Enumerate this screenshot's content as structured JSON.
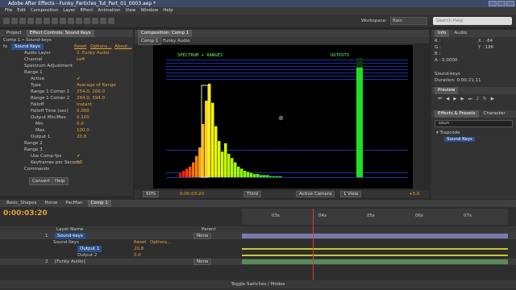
{
  "app": {
    "title": "Adobe After Effects - Funky_Particles_Tut_Part_01_0003.aep *"
  },
  "menu": [
    "File",
    "Edit",
    "Composition",
    "Layer",
    "Effect",
    "Animation",
    "View",
    "Window",
    "Help"
  ],
  "workspace": {
    "label": "Workspace:",
    "value": "Rain",
    "search_placeholder": "Search Help"
  },
  "fx_panel": {
    "tabs": [
      "Project",
      "Effect Controls: Sound Keys"
    ],
    "breadcrumb": "Comp 1 • Sound-keys",
    "effect_name": "Sound Keys",
    "reset": "Reset",
    "options": "Options...",
    "about": "About...",
    "rows": [
      {
        "label": "Audio Layer",
        "value": "2. Funky Audio"
      },
      {
        "label": "Channel",
        "value": "Left"
      },
      {
        "label": "Spectrum Adjustment",
        "value": ""
      },
      {
        "label": "Range 1",
        "value": ""
      },
      {
        "label": "Active",
        "value": "✔"
      },
      {
        "label": "Type",
        "value": "Average of Range"
      },
      {
        "label": "Range 1 Corner 1",
        "value": "254.0, 206.0"
      },
      {
        "label": "Range 1 Corner 2",
        "value": "264.0, 394.0"
      },
      {
        "label": "Falloff",
        "value": "Instant"
      },
      {
        "label": "Falloff Time (sec)",
        "value": "0.000"
      },
      {
        "label": "Output Min/Max",
        "value": "0.100"
      },
      {
        "label": "Min",
        "value": "0.0"
      },
      {
        "label": "Max",
        "value": "100.0"
      },
      {
        "label": "Output 1",
        "value": "20.8"
      },
      {
        "label": "Range 2",
        "value": ""
      },
      {
        "label": "Range 3",
        "value": ""
      },
      {
        "label": "Use Comp fps",
        "value": "✔"
      },
      {
        "label": "Keyframes per Second",
        "value": "10"
      },
      {
        "label": "Commands",
        "value": ""
      }
    ],
    "convert": "Convert",
    "help": "Help"
  },
  "comp": {
    "tabs": [
      "Composition: Comp 1"
    ],
    "breadcrumb": [
      "Comp 1",
      "Funky Audio"
    ],
    "spectrum_label": "SPECTRUM + RANGES",
    "outputs_label": "OUTPUTS",
    "footer": {
      "zoom": "50%",
      "time": "0:00:03:20",
      "res": "Third",
      "view": "Active Camera",
      "views": "1 View",
      "exposure": "+0.0"
    }
  },
  "info": {
    "tabs": [
      "Info",
      "Audio"
    ],
    "R": "R :",
    "G": "G :",
    "B": "B :",
    "A": "A : 0.0000",
    "X": "X : -84",
    "Y": "Y : 186",
    "layer": "Sound-keys",
    "duration": "Duration: 0:00:21:11"
  },
  "preview": {
    "tab": "Preview"
  },
  "effects_presets": {
    "tabs": [
      "Effects & Presets",
      "Character"
    ],
    "search": "soun",
    "category": "Trapcode",
    "item": "Sound Keys"
  },
  "timeline": {
    "tabs": [
      "Basic_Shapes",
      "Horse",
      "PacMan",
      "Comp 1"
    ],
    "timecode": "0:00:03:20",
    "col_header": "Layer Name",
    "parent_header": "Parent",
    "ruler": [
      "00s",
      "03s",
      "04s",
      "05s",
      "06s",
      "07s"
    ],
    "layers": [
      {
        "num": "1",
        "name": "Sound-keys",
        "parent": "None"
      },
      {
        "num": "",
        "name": "Sound Keys",
        "parent": "",
        "reset": "Reset",
        "options": "Options..."
      },
      {
        "num": "",
        "name": "Output 1",
        "parent": "",
        "value": "20.8"
      },
      {
        "num": "",
        "name": "Output 2",
        "parent": "",
        "value": "0.0"
      },
      {
        "num": "2",
        "name": "[Funky Audio]",
        "parent": "None"
      }
    ],
    "footer": "Toggle Switches / Modes"
  },
  "chart_data": {
    "type": "bar",
    "values": [
      4,
      6,
      8,
      10,
      14,
      20,
      28,
      50,
      72,
      88,
      70,
      48,
      34,
      24,
      32,
      22,
      18,
      14,
      10,
      8,
      6,
      5,
      4,
      3,
      3,
      2,
      2,
      2,
      1,
      1,
      1,
      1
    ],
    "output_level": [
      0.92
    ]
  }
}
